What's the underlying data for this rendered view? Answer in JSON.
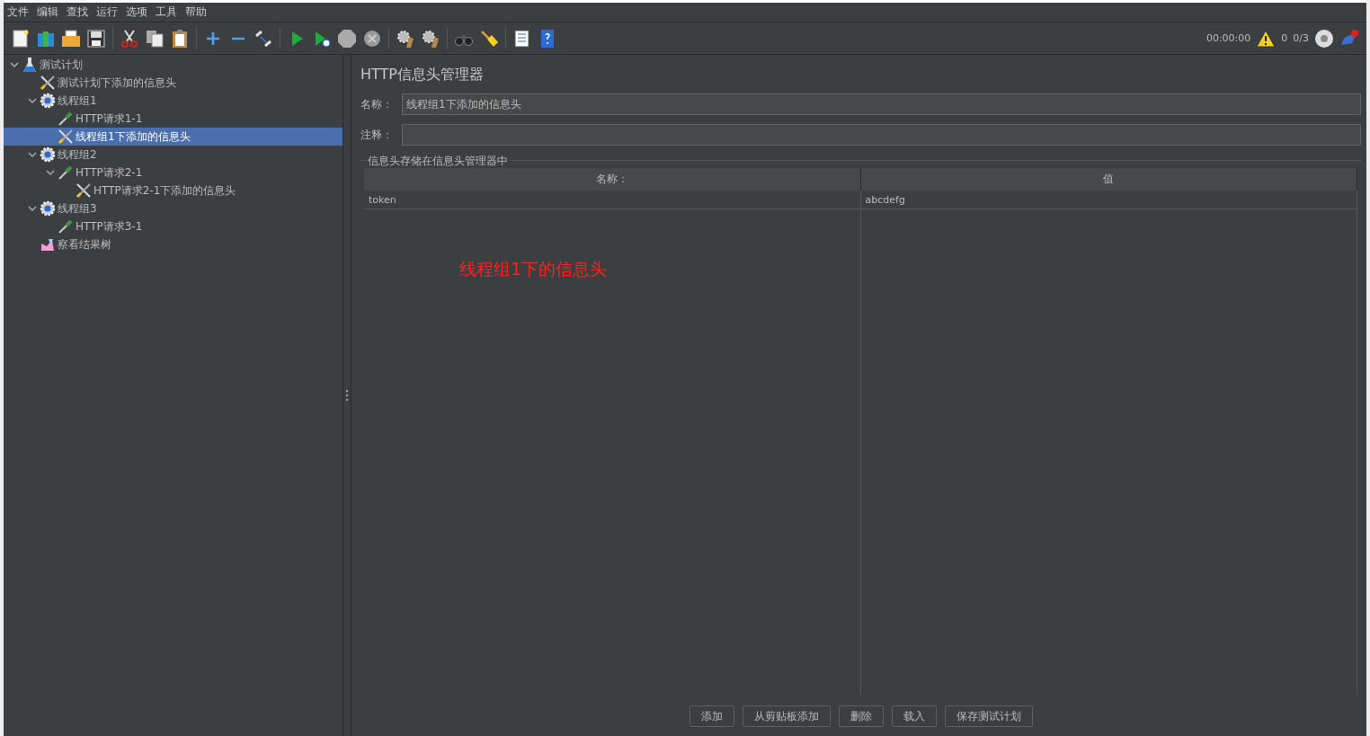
{
  "menu": [
    "文件",
    "编辑",
    "查找",
    "运行",
    "选项",
    "工具",
    "帮助"
  ],
  "status": {
    "timer": "00:00:00",
    "warnings": "0",
    "threads": "0/3"
  },
  "tree": [
    {
      "label": "测试计划",
      "kind": "plan",
      "expanded": true,
      "selected": false,
      "children": [
        {
          "label": "测试计划下添加的信息头",
          "kind": "header",
          "selected": false
        },
        {
          "label": "线程组1",
          "kind": "thread_group",
          "expanded": true,
          "selected": false,
          "children": [
            {
              "label": "HTTP请求1-1",
              "kind": "sampler",
              "selected": false
            },
            {
              "label": "线程组1下添加的信息头",
              "kind": "header",
              "selected": true
            }
          ]
        },
        {
          "label": "线程组2",
          "kind": "thread_group",
          "expanded": true,
          "selected": false,
          "children": [
            {
              "label": "HTTP请求2-1",
              "kind": "sampler",
              "expanded": true,
              "selected": false,
              "children": [
                {
                  "label": "HTTP请求2-1下添加的信息头",
                  "kind": "header",
                  "selected": false
                }
              ]
            }
          ]
        },
        {
          "label": "线程组3",
          "kind": "thread_group",
          "expanded": true,
          "selected": false,
          "children": [
            {
              "label": "HTTP请求3-1",
              "kind": "sampler",
              "selected": false
            }
          ]
        },
        {
          "label": "察看结果树",
          "kind": "listener",
          "selected": false
        }
      ]
    }
  ],
  "panel": {
    "title": "HTTP信息头管理器",
    "name_label": "名称：",
    "name_value": "线程组1下添加的信息头",
    "comment_label": "注释：",
    "group_title": "信息头存储在信息头管理器中",
    "table": {
      "columns": [
        "名称：",
        "值"
      ],
      "rows": [
        [
          "token",
          "abcdefg"
        ]
      ]
    },
    "annotation": "线程组1下的信息头",
    "buttons": [
      "添加",
      "从剪贴板添加",
      "删除",
      "载入",
      "保存测试计划"
    ]
  }
}
